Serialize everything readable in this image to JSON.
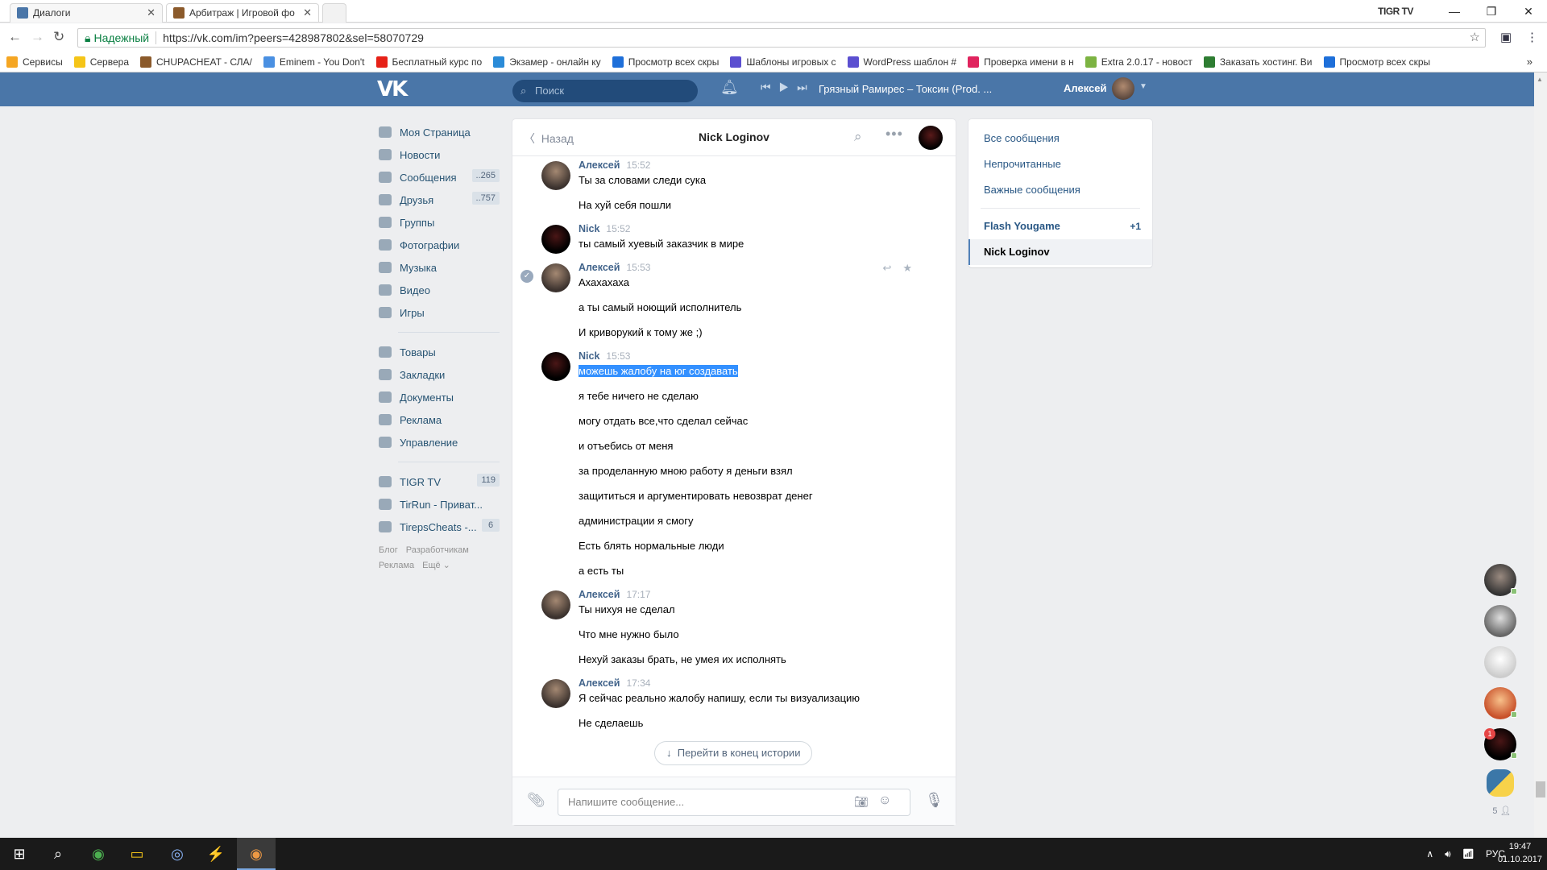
{
  "browser": {
    "tabs": [
      {
        "title": "Диалоги",
        "active": true
      },
      {
        "title": "Арбитраж | Игровой фо",
        "active": false
      }
    ],
    "profile": "TIGR TV",
    "secure_label": "Надежный",
    "url": "https://vk.com/im?peers=428987802&sel=58070729",
    "bookmarks": [
      "Сервисы",
      "Сервера",
      "CHUPACHEAT - СЛА/",
      "Eminem - You Don't",
      "Бесплатный курс по",
      "Экзамер - онлайн ку",
      "Просмотр всех скры",
      "Шаблоны игровых с",
      "WordPress шаблон #",
      "Проверка имени в н",
      "Extra 2.0.17 - новост",
      "Заказать хостинг. Ви",
      "Просмотр всех скры"
    ],
    "bookmark_colors": [
      "#f5a623",
      "#f5c518",
      "#8b5a2b",
      "#4a90e2",
      "#e62117",
      "#2a8bd8",
      "#1e6fd9",
      "#5b4fd0",
      "#5b4fd0",
      "#e0245e",
      "#7cb342",
      "#2e7d32",
      "#1e6fd9"
    ]
  },
  "vk": {
    "search_placeholder": "Поиск",
    "track": "Грязный Рамирес – Токсин (Prod. ...",
    "user": "Алексей"
  },
  "leftnav": {
    "items": [
      {
        "label": "Моя Страница",
        "count": ""
      },
      {
        "label": "Новости",
        "count": ""
      },
      {
        "label": "Сообщения",
        "count": "..265"
      },
      {
        "label": "Друзья",
        "count": "..757"
      },
      {
        "label": "Группы",
        "count": ""
      },
      {
        "label": "Фотографии",
        "count": ""
      },
      {
        "label": "Музыка",
        "count": ""
      },
      {
        "label": "Видео",
        "count": ""
      },
      {
        "label": "Игры",
        "count": ""
      }
    ],
    "items2": [
      {
        "label": "Товары"
      },
      {
        "label": "Закладки"
      },
      {
        "label": "Документы"
      },
      {
        "label": "Реклама"
      },
      {
        "label": "Управление"
      }
    ],
    "groups": [
      {
        "label": "TIGR TV",
        "count": "119"
      },
      {
        "label": "TirRun - Приват...",
        "count": ""
      },
      {
        "label": "TirepsCheats -...",
        "count": "6"
      }
    ],
    "footer": [
      "Блог",
      "Разработчикам",
      "Реклама",
      "Ещё ⌄"
    ]
  },
  "dialog": {
    "back": "Назад",
    "title": "Nick Loginov",
    "groups": [
      {
        "name": "Алексей",
        "time": "15:52",
        "who": "a",
        "lines": [
          "Ты за словами следи сука",
          "На хуй себя пошли"
        ]
      },
      {
        "name": "Nick",
        "time": "15:52",
        "who": "n",
        "lines": [
          "ты самый хуевый заказчик в мире"
        ]
      },
      {
        "name": "Алексей",
        "time": "15:53",
        "who": "a",
        "lines": [
          "Ахахахаха",
          "а ты самый ноющий исполнитель",
          "И криворукий к тому же ;)"
        ]
      },
      {
        "name": "Nick",
        "time": "15:53",
        "who": "n",
        "lines": [
          "можешь жалобу на юг создавать",
          "я тебе ничего не сделаю",
          "могу отдать все,что сделал сейчас",
          "и отъебись от меня",
          "за проделанную мною работу я деньги взял",
          "защититься и аргументировать невозврат денег",
          "администрации я смогу",
          "Есть блять нормальные люди",
          "а есть ты"
        ]
      },
      {
        "name": "Алексей",
        "time": "17:17",
        "who": "a",
        "lines": [
          "Ты нихуя не сделал",
          "Что мне нужно было",
          "Нехуй заказы брать, не умея их исполнять"
        ]
      },
      {
        "name": "Алексей",
        "time": "17:34",
        "who": "a",
        "lines": [
          "Я сейчас реально жалобу напишу, если ты визуализацию",
          "Не сделаешь"
        ]
      }
    ],
    "to_bottom": "Перейти в конец истории",
    "input_placeholder": "Напишите сообщение..."
  },
  "rightmenu": {
    "filters": [
      "Все сообщения",
      "Непрочитанные",
      "Важные сообщения"
    ],
    "chats": [
      {
        "label": "Flash Yougame",
        "badge": "+1"
      },
      {
        "label": "Nick Loginov",
        "badge": ""
      }
    ]
  },
  "friends": {
    "count": "5"
  },
  "taskbar": {
    "lang": "РУС",
    "time": "19:47",
    "date": "01.10.2017"
  }
}
